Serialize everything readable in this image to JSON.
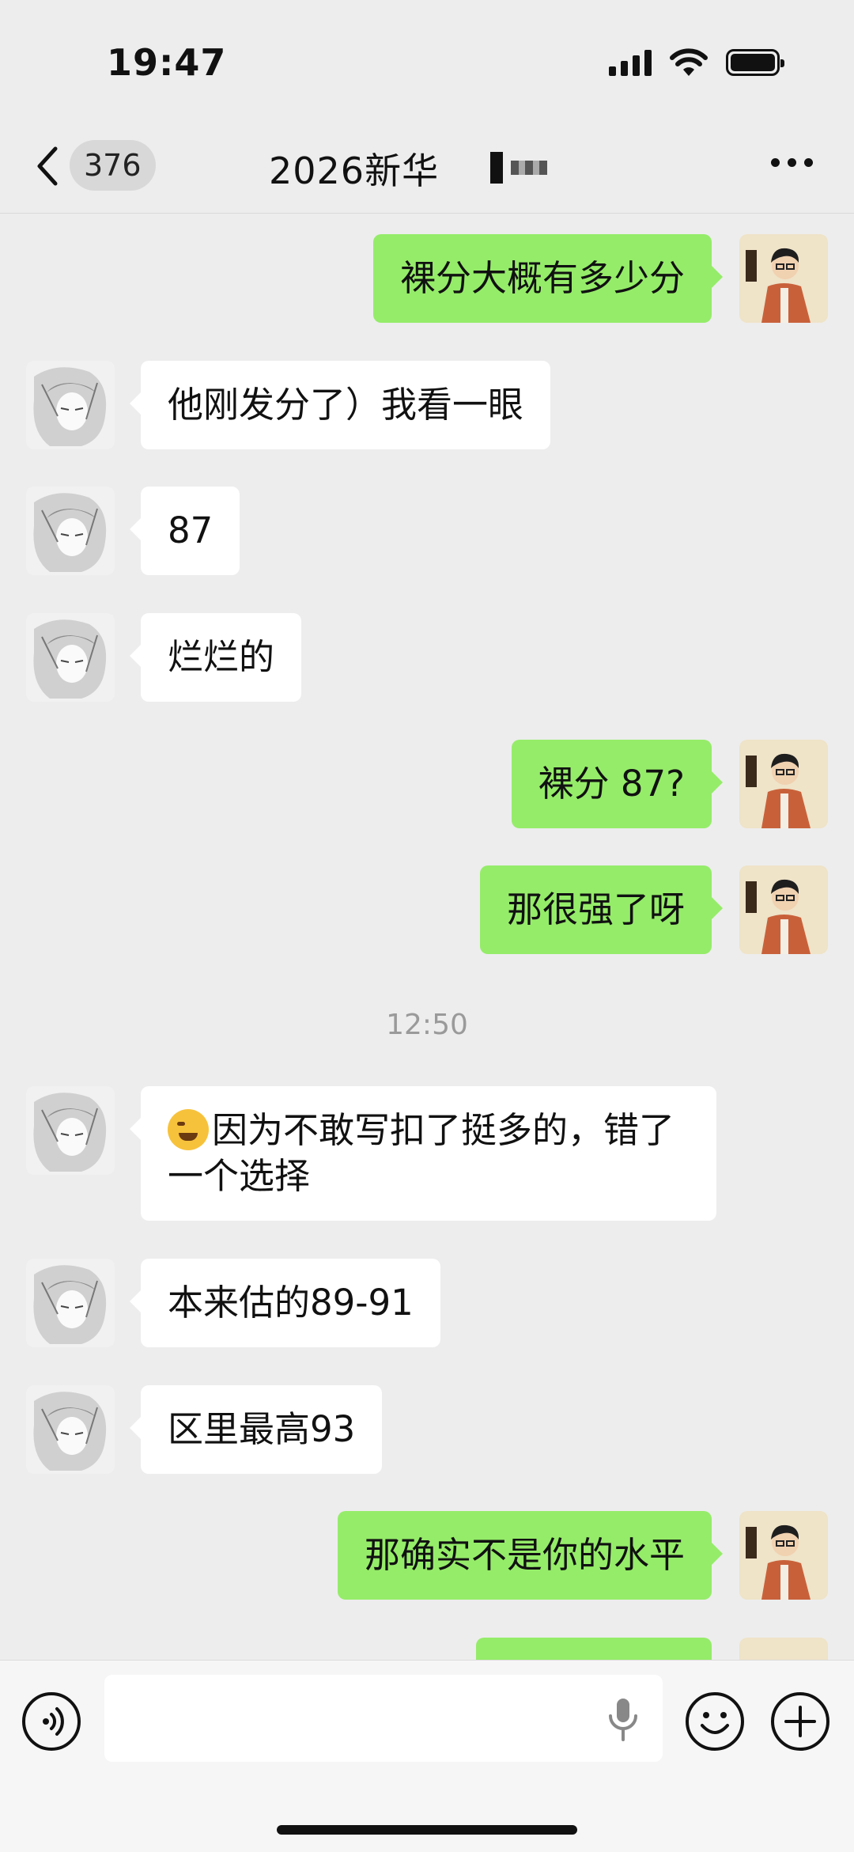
{
  "status_bar": {
    "time": "19:47"
  },
  "nav": {
    "unread_count": "376",
    "title": "2026新华"
  },
  "messages": [
    {
      "side": "right",
      "text": "裸分大概有多少分"
    },
    {
      "side": "left",
      "text": "他刚发分了）我看一眼"
    },
    {
      "side": "left",
      "text": "87"
    },
    {
      "side": "left",
      "text": "烂烂的"
    },
    {
      "side": "right",
      "text": "裸分 87?"
    },
    {
      "side": "right",
      "text": "那很强了呀"
    },
    {
      "side": "left",
      "text": "因为不敢写扣了挺多的，错了一个选择",
      "emoji": "crying-face"
    },
    {
      "side": "left",
      "text": "本来估的89-91"
    },
    {
      "side": "left",
      "text": "区里最高93"
    },
    {
      "side": "right",
      "text": "那确实不是你的水平"
    }
  ],
  "time_divider": "12:50",
  "input": {
    "value": "",
    "placeholder": ""
  },
  "colors": {
    "background": "#ededed",
    "outgoing_bubble": "#95ec69",
    "incoming_bubble": "#ffffff",
    "input_bar": "#f6f6f6"
  },
  "icons": [
    "back-arrow-icon",
    "more-icon",
    "voice-icon",
    "microphone-icon",
    "emoji-icon",
    "plus-icon",
    "signal-icon",
    "wifi-icon",
    "battery-icon"
  ]
}
